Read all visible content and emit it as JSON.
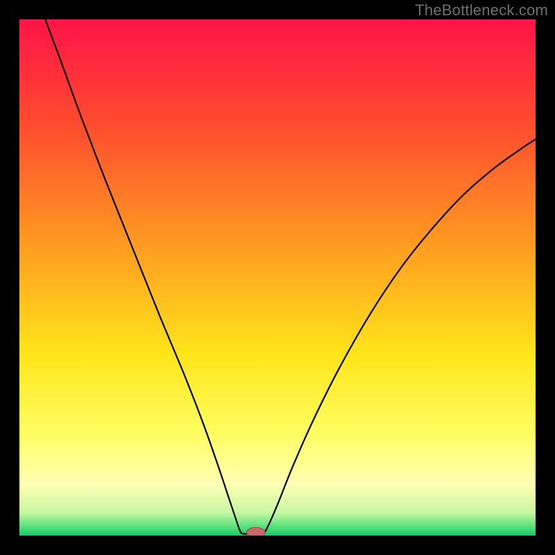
{
  "watermark": "TheBottleneck.com",
  "colors": {
    "frame": "#000000",
    "curve": "#000000",
    "marker_fill": "#cc6666",
    "marker_stroke": "#9c4848",
    "gradient_stops": [
      {
        "offset": 0.0,
        "color": "#ff1447"
      },
      {
        "offset": 0.2,
        "color": "#ff4a2f"
      },
      {
        "offset": 0.45,
        "color": "#ffa020"
      },
      {
        "offset": 0.65,
        "color": "#ffe51a"
      },
      {
        "offset": 0.8,
        "color": "#fdfd60"
      },
      {
        "offset": 0.9,
        "color": "#feffb3"
      },
      {
        "offset": 0.955,
        "color": "#c8f7a2"
      },
      {
        "offset": 0.985,
        "color": "#4de07a"
      },
      {
        "offset": 1.0,
        "color": "#18c768"
      }
    ]
  },
  "chart_data": {
    "type": "line",
    "title": "",
    "xlabel": "",
    "ylabel": "",
    "x_range": [
      0,
      1
    ],
    "y_range": [
      0,
      1
    ],
    "series": [
      {
        "name": "bottleneck-curve",
        "segments": [
          {
            "name": "left-descent",
            "points": [
              {
                "x": 0.05,
                "y": 1.0
              },
              {
                "x": 0.08,
                "y": 0.92
              },
              {
                "x": 0.12,
                "y": 0.81
              },
              {
                "x": 0.17,
                "y": 0.68
              },
              {
                "x": 0.22,
                "y": 0.555
              },
              {
                "x": 0.27,
                "y": 0.43
              },
              {
                "x": 0.32,
                "y": 0.31
              },
              {
                "x": 0.355,
                "y": 0.22
              },
              {
                "x": 0.385,
                "y": 0.135
              },
              {
                "x": 0.405,
                "y": 0.075
              },
              {
                "x": 0.42,
                "y": 0.03
              },
              {
                "x": 0.427,
                "y": 0.01
              },
              {
                "x": 0.432,
                "y": 0.004
              }
            ]
          },
          {
            "name": "valley-floor",
            "points": [
              {
                "x": 0.432,
                "y": 0.004
              },
              {
                "x": 0.45,
                "y": 0.003
              },
              {
                "x": 0.47,
                "y": 0.003
              }
            ]
          },
          {
            "name": "right-ascent",
            "points": [
              {
                "x": 0.47,
                "y": 0.003
              },
              {
                "x": 0.48,
                "y": 0.015
              },
              {
                "x": 0.5,
                "y": 0.06
              },
              {
                "x": 0.53,
                "y": 0.135
              },
              {
                "x": 0.57,
                "y": 0.225
              },
              {
                "x": 0.62,
                "y": 0.325
              },
              {
                "x": 0.68,
                "y": 0.43
              },
              {
                "x": 0.74,
                "y": 0.52
              },
              {
                "x": 0.8,
                "y": 0.595
              },
              {
                "x": 0.86,
                "y": 0.66
              },
              {
                "x": 0.92,
                "y": 0.712
              },
              {
                "x": 0.97,
                "y": 0.748
              },
              {
                "x": 1.0,
                "y": 0.768
              }
            ]
          }
        ]
      }
    ],
    "marker": {
      "x": 0.458,
      "y": 0.006,
      "rx": 0.018,
      "ry": 0.01
    },
    "background": "vertical-rainbow-gradient"
  }
}
